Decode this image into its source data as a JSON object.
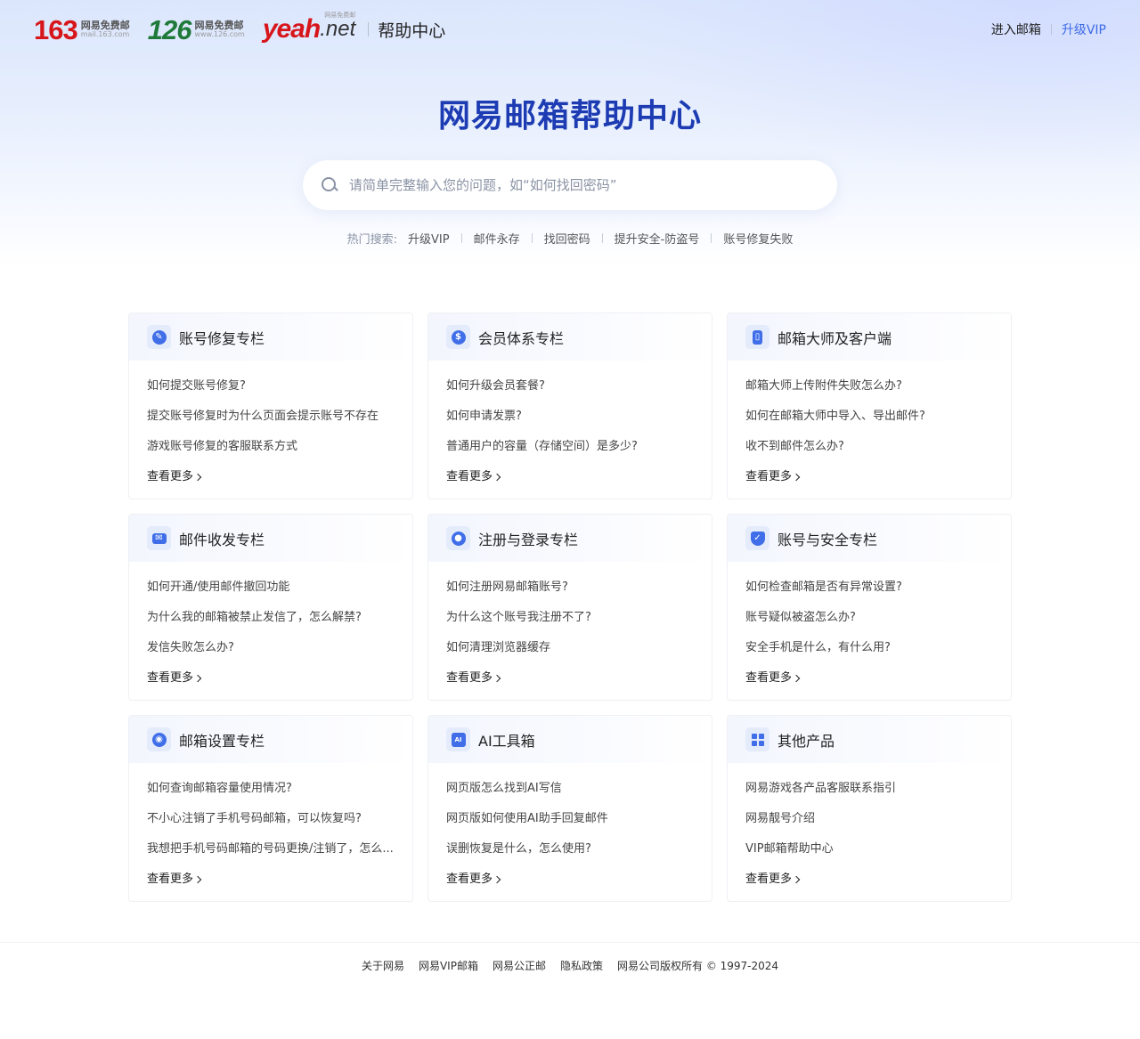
{
  "header": {
    "logos": [
      {
        "num": "163",
        "sub1": "网易免费邮",
        "sub2": "mail.163.com"
      },
      {
        "num": "126",
        "sub1": "网易免费邮",
        "sub2": "www.126.com"
      }
    ],
    "yeah": {
      "part1": "yeah",
      "part2": ".net",
      "tag": "网易免费邮"
    },
    "help_title": "帮助中心",
    "enter_label": "进入邮箱",
    "vip_label": "升级VIP"
  },
  "hero": {
    "title": "网易邮箱帮助中心",
    "search_placeholder": "请简单完整输入您的问题，如“如何找回密码”",
    "hot_label": "热门搜索:",
    "hot_items": [
      "升级VIP",
      "邮件永存",
      "找回密码",
      "提升安全-防盗号",
      "账号修复失败"
    ]
  },
  "cards": [
    {
      "title": "账号修复专栏",
      "icon": "wrench-icon",
      "items": [
        "如何提交账号修复?",
        "提交账号修复时为什么页面会提示账号不存在",
        "游戏账号修复的客服联系方式"
      ],
      "more": "查看更多"
    },
    {
      "title": "会员体系专栏",
      "icon": "dollar-icon",
      "items": [
        "如何升级会员套餐?",
        "如何申请发票?",
        "普通用户的容量（存储空间）是多少?"
      ],
      "more": "查看更多"
    },
    {
      "title": "邮箱大师及客户端",
      "icon": "phone-icon",
      "items": [
        "邮箱大师上传附件失败怎么办?",
        "如何在邮箱大师中导入、导出邮件?",
        "收不到邮件怎么办?"
      ],
      "more": "查看更多"
    },
    {
      "title": "邮件收发专栏",
      "icon": "envelope-icon",
      "items": [
        "如何开通/使用邮件撤回功能",
        "为什么我的邮箱被禁止发信了，怎么解禁?",
        "发信失败怎么办?"
      ],
      "more": "查看更多"
    },
    {
      "title": "注册与登录专栏",
      "icon": "user-icon",
      "items": [
        "如何注册网易邮箱账号?",
        "为什么这个账号我注册不了?",
        "如何清理浏览器缓存"
      ],
      "more": "查看更多"
    },
    {
      "title": "账号与安全专栏",
      "icon": "shield-icon",
      "items": [
        "如何检查邮箱是否有异常设置?",
        "账号疑似被盗怎么办?",
        "安全手机是什么，有什么用?"
      ],
      "more": "查看更多"
    },
    {
      "title": "邮箱设置专栏",
      "icon": "settings-icon",
      "items": [
        "如何查询邮箱容量使用情况?",
        "不小心注销了手机号码邮箱，可以恢复吗?",
        "我想把手机号码邮箱的号码更换/注销了，怎么..."
      ],
      "more": "查看更多"
    },
    {
      "title": "AI工具箱",
      "icon": "ai-toolbox-icon",
      "items": [
        "网页版怎么找到AI写信",
        "网页版如何使用AI助手回复邮件",
        "误删恢复是什么，怎么使用?"
      ],
      "more": "查看更多"
    },
    {
      "title": "其他产品",
      "icon": "grid-icon",
      "items": [
        "网易游戏各产品客服联系指引",
        "网易靓号介绍",
        "VIP邮箱帮助中心"
      ],
      "more": "查看更多"
    }
  ],
  "footer": {
    "links": [
      "关于网易",
      "网易VIP邮箱",
      "网易公正邮",
      "隐私政策"
    ],
    "copyright": "网易公司版权所有 © 1997-2024"
  }
}
